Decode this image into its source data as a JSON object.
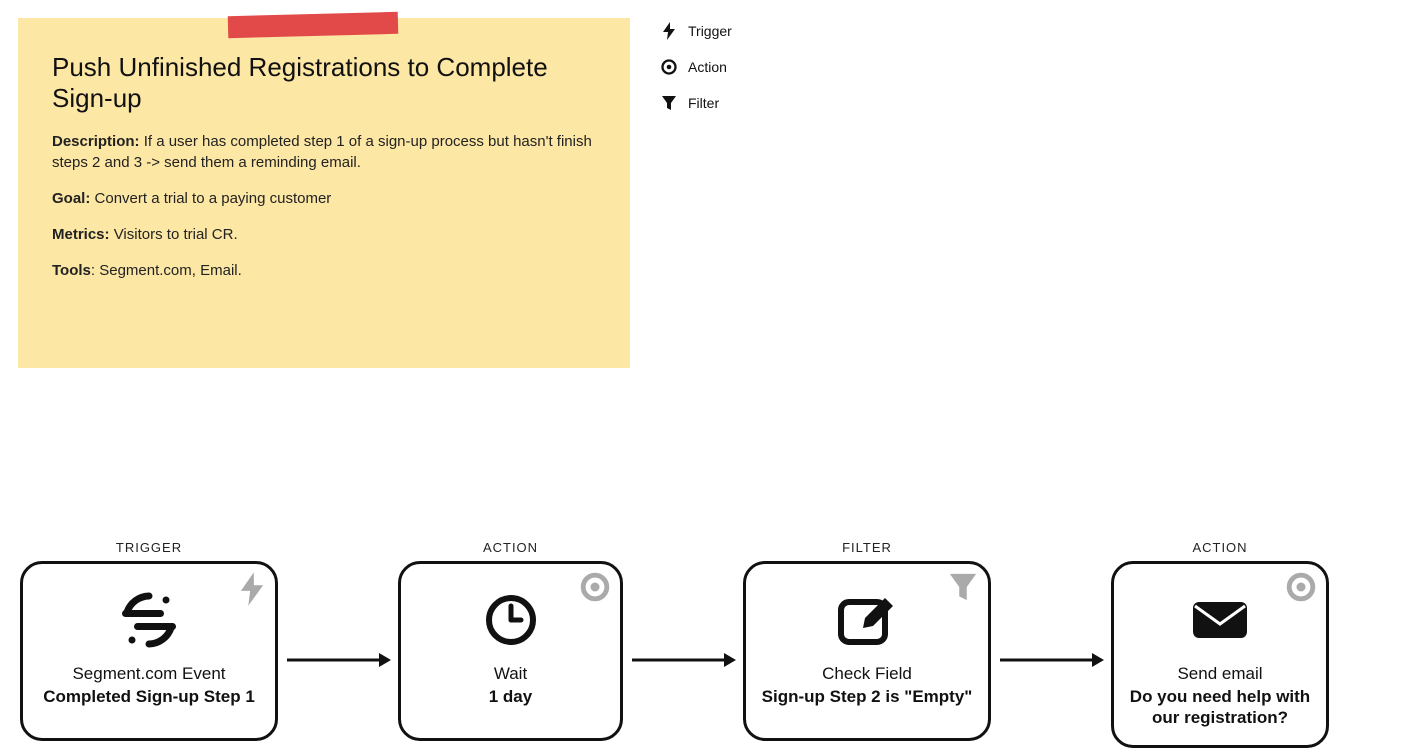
{
  "note": {
    "title": "Push Unfinished Registrations to Complete Sign-up",
    "description_label": "Description:",
    "description_text": "If a user has completed step 1 of a sign-up process but hasn't finish steps 2 and 3 -> send them a reminding email.",
    "goal_label": "Goal:",
    "goal_text": "Convert a trial to a paying customer",
    "metrics_label": "Metrics:",
    "metrics_text": "Visitors to trial CR.",
    "tools_label": "Tools",
    "tools_text": ": Segment.com, Email."
  },
  "legend": {
    "trigger": "Trigger",
    "action": "Action",
    "filter": "Filter"
  },
  "flow": [
    {
      "type": "TRIGGER",
      "line1": "Segment.com Event",
      "line2": "Completed Sign-up Step 1"
    },
    {
      "type": "ACTION",
      "line1": "Wait",
      "line2": "1 day"
    },
    {
      "type": "FILTER",
      "line1": "Check Field",
      "line2": "Sign-up Step 2 is \"Empty\""
    },
    {
      "type": "ACTION",
      "line1": "Send email",
      "line2": "Do you need help with our registration?"
    }
  ]
}
